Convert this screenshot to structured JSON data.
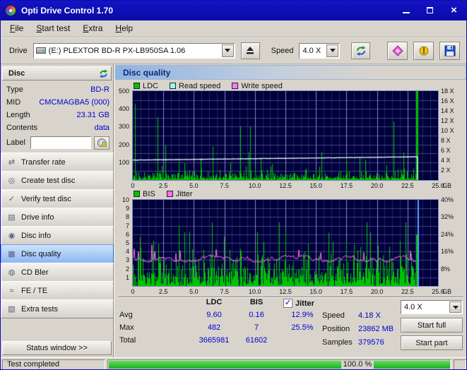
{
  "window": {
    "title": "Opti Drive Control 1.70"
  },
  "menu": {
    "items": [
      "File",
      "Start test",
      "Extra",
      "Help"
    ]
  },
  "toolbar": {
    "drive_label": "Drive",
    "drive_value": "(E:)  PLEXTOR BD-R  PX-LB950SA 1.06",
    "speed_label": "Speed",
    "speed_value": "4.0 X"
  },
  "icons": {
    "app-icon": "optical-disc",
    "minimize-icon": "window-minimize",
    "maximize-icon": "window-maximize",
    "close-icon": "window-close",
    "drive-icon": "optical-drive",
    "eject-icon": "eject-triangle-over-bar",
    "refresh-icon": "green-blue-circular-arrows",
    "erase-icon": "pink-diamond-eraser",
    "settings-icon": "yellow-tool",
    "save-icon": "blue-floppy-disk",
    "disc-refresh-icon": "green-blue-circular-arrows-small",
    "label-edit-icon": "disc-write",
    "checkbox-checked-icon": "checkmark",
    "dropdown-arrow-icon": "triangle-down"
  },
  "sidebar": {
    "disc_header": "Disc",
    "fields": [
      {
        "label": "Type",
        "value": "BD-R"
      },
      {
        "label": "MID",
        "value": "CMCMAGBA5 (000)"
      },
      {
        "label": "Length",
        "value": "23.31 GB"
      },
      {
        "label": "Contents",
        "value": "data"
      }
    ],
    "label_field": {
      "label": "Label",
      "value": ""
    },
    "nav": [
      {
        "label": "Transfer rate",
        "icon": "transfer-rate-icon"
      },
      {
        "label": "Create test disc",
        "icon": "create-test-disc-icon"
      },
      {
        "label": "Verify test disc",
        "icon": "verify-test-disc-icon"
      },
      {
        "label": "Drive info",
        "icon": "drive-info-icon"
      },
      {
        "label": "Disc info",
        "icon": "disc-info-icon"
      },
      {
        "label": "Disc quality",
        "icon": "disc-quality-icon",
        "active": true
      },
      {
        "label": "CD Bler",
        "icon": "cd-bler-icon"
      },
      {
        "label": "FE / TE",
        "icon": "fe-te-icon"
      },
      {
        "label": "Extra tests",
        "icon": "extra-tests-icon"
      }
    ],
    "status_window": "Status window >>"
  },
  "main": {
    "panel_title": "Disc quality",
    "legend_top": [
      {
        "label": "LDC",
        "color": "#00c400"
      },
      {
        "label": "Read speed",
        "color": "#9ff4ff"
      },
      {
        "label": "Write speed",
        "color": "#ff7dff"
      }
    ],
    "legend_bottom": [
      {
        "label": "BIS",
        "color": "#00c400"
      },
      {
        "label": "Jitter",
        "color": "#ff6ef0"
      }
    ],
    "stats": {
      "columns": [
        "LDC",
        "BIS"
      ],
      "jitter_label": "Jitter",
      "jitter_checked": true,
      "rows": [
        {
          "label": "Avg",
          "values": [
            "9.60",
            "0.16",
            "12.9%"
          ]
        },
        {
          "label": "Max",
          "values": [
            "482",
            "7",
            "25.5%"
          ]
        },
        {
          "label": "Total",
          "values": [
            "3665981",
            "61602",
            ""
          ]
        }
      ],
      "right": {
        "speed_label": "Speed",
        "speed_value": "4.18 X",
        "position_label": "Position",
        "position_value": "23862 MB",
        "samples_label": "Samples",
        "samples_value": "379576"
      },
      "speed_select": "4.0 X",
      "start_full": "Start full",
      "start_part": "Start part"
    }
  },
  "statusbar": {
    "text": "Test completed",
    "percent": "100.0 %"
  },
  "chart_data": [
    {
      "type": "bar+line",
      "title": "LDC errors and read speed vs disc position",
      "x_axis": {
        "ticks": [
          "0",
          "2.5",
          "5.0",
          "7.5",
          "10.0",
          "12.5",
          "15.0",
          "17.5",
          "20.0",
          "22.5",
          "25.0"
        ],
        "unit": "GB",
        "max_gb": 25
      },
      "left_axis": {
        "name": "LDC",
        "ticks": [
          100,
          200,
          300,
          400,
          500
        ],
        "max": 500
      },
      "right_axis": {
        "name": "Speed",
        "ticks": [
          2,
          4,
          6,
          8,
          10,
          12,
          14,
          16,
          18
        ],
        "suffix": " X",
        "max": 18
      },
      "series": [
        {
          "name": "LDC",
          "type": "bar",
          "color": "#00c400",
          "avg": 9.6,
          "max": 482,
          "total": 3665981
        },
        {
          "name": "Read speed",
          "type": "line",
          "color": "#e2ffff",
          "start_speed_x": 4.05,
          "end_speed_x": 4.7
        },
        {
          "name": "Write speed",
          "type": "line",
          "color": "#ff7dff",
          "plotted": false
        }
      ],
      "data_end_gb": 23.31,
      "grid": true,
      "background": "#00003a"
    },
    {
      "type": "bar+line",
      "title": "BIS errors and jitter vs disc position",
      "x_axis": {
        "ticks": [
          "0",
          "2.5",
          "5.0",
          "7.5",
          "10.0",
          "12.5",
          "15.0",
          "17.5",
          "20.0",
          "22.5",
          "25.0"
        ],
        "unit": "GB",
        "max_gb": 25
      },
      "left_axis": {
        "name": "BIS",
        "ticks": [
          1,
          2,
          3,
          4,
          5,
          6,
          7,
          8,
          9,
          10
        ],
        "max": 10
      },
      "right_axis": {
        "name": "Jitter",
        "ticks": [
          8,
          16,
          24,
          32,
          40
        ],
        "suffix": "%",
        "max": 40
      },
      "series": [
        {
          "name": "BIS",
          "type": "bar",
          "color": "#00c400",
          "avg": 0.16,
          "max": 7,
          "total": 61602
        },
        {
          "name": "Jitter",
          "type": "line",
          "color": "#ff6ef0",
          "avg_pct": 12.9,
          "max_pct": 25.5
        }
      ],
      "data_end_gb": 23.31,
      "grid": true,
      "background": "#00003a"
    }
  ]
}
